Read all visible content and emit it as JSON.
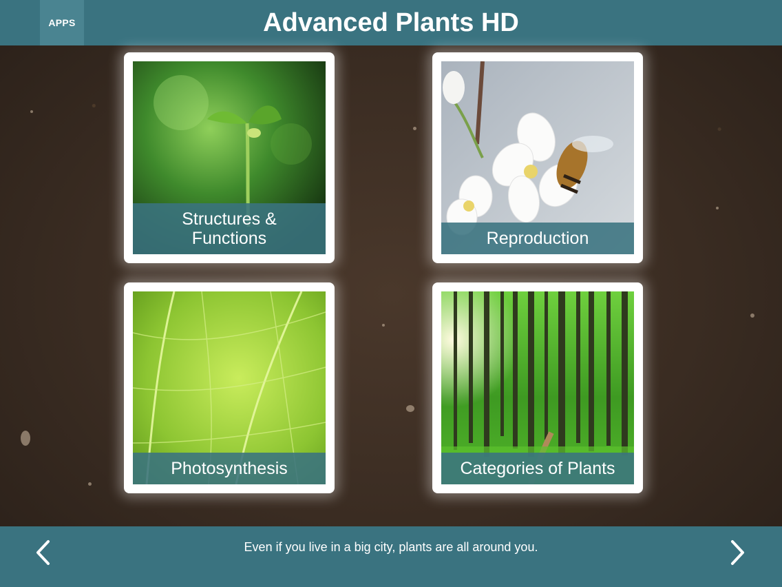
{
  "header": {
    "apps_label": "APPS",
    "title": "Advanced Plants HD"
  },
  "tiles": [
    {
      "label_line1": "Structures &",
      "label_line2": "Functions",
      "image": "seedling-photo"
    },
    {
      "label": "Reproduction",
      "image": "bee-on-blossom-photo"
    },
    {
      "label": "Photosynthesis",
      "image": "leaf-veins-photo"
    },
    {
      "label": "Categories of Plants",
      "image": "forest-photo"
    }
  ],
  "footer": {
    "caption": "Even if you live in a big city, plants are all around you.",
    "prev_icon": "chevron-left-icon",
    "next_icon": "chevron-right-icon"
  },
  "colors": {
    "bar": "#3a7380",
    "apps_button": "#4a8491",
    "soil": "#3a2c22"
  }
}
